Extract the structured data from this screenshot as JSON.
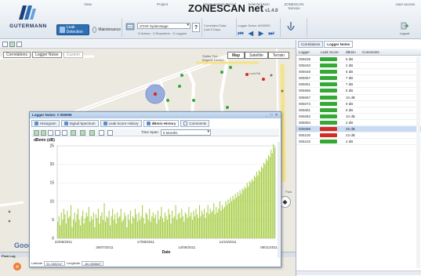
{
  "app": {
    "title": "ZONESCAN net",
    "version": "v1.4.8",
    "company": "GUTERMANN"
  },
  "header": {
    "sections": [
      "View",
      "Project",
      "Measurement Period",
      "Selected Item",
      "ZONESCAN Service",
      "User access"
    ],
    "leak_detection": "Leak Detection",
    "maintenance": "Maintenance",
    "project_value": "STAR Sydenstage",
    "project_stats": "5 Noises · 0 Repeaters · 6 Loggers",
    "help": "?",
    "measurement_line1": "Correlated Data",
    "measurement_line2": "Last 3 Days",
    "selected_line1": "Logger Noise: #005099",
    "nav_arrows": [
      "⏮",
      "◀",
      "▶",
      "⏭"
    ],
    "logout": "Logout"
  },
  "map": {
    "tabs": [
      "Correlations",
      "Logger Noise",
      "Custom"
    ],
    "types": [
      "Map",
      "Satellite",
      "Terrain"
    ],
    "place_labels": [
      "Slatter Fire Brigade District",
      "Lord Rd",
      "Park"
    ],
    "google_mark": "Google",
    "flow_log": "Flow Log"
  },
  "dialog": {
    "title": "Logger Notes: # 005099",
    "window_buttons": "_ □ ×",
    "tabs": [
      "Histogram",
      "Signal Spectrum",
      "Leak Score History",
      "dBmin History",
      "Comments"
    ],
    "active_tab_index": 3,
    "time_span_label": "Time Span:",
    "time_span_value": "6 Months",
    "latitude_label": "Latitude",
    "latitude_value": "51.158214°",
    "longitude_label": "Longitude",
    "longitude_value": "-80.280666°"
  },
  "right_panel": {
    "tabs": [
      "Correlations",
      "Logger Notes"
    ],
    "columns": [
      "Logger",
      "Leak Score",
      "dBmin",
      "Comments"
    ],
    "rows": [
      {
        "logger": "005039",
        "dbmin": "6 dB",
        "status": "ok"
      },
      {
        "logger": "005040",
        "dbmin": "2 dB",
        "status": "ok"
      },
      {
        "logger": "005048",
        "dbmin": "5 dB",
        "status": "ok"
      },
      {
        "logger": "005057",
        "dbmin": "7 dB",
        "status": "ok"
      },
      {
        "logger": "005061",
        "dbmin": "7 dB",
        "status": "ok"
      },
      {
        "logger": "005065",
        "dbmin": "5 dB",
        "status": "ok"
      },
      {
        "logger": "005067",
        "dbmin": "10 dB",
        "status": "ok"
      },
      {
        "logger": "005073",
        "dbmin": "9 dB",
        "status": "ok"
      },
      {
        "logger": "005081",
        "dbmin": "6 dB",
        "status": "ok"
      },
      {
        "logger": "005082",
        "dbmin": "10 dB",
        "status": "ok"
      },
      {
        "logger": "005094",
        "dbmin": "2 dB",
        "status": "ok"
      },
      {
        "logger": "005099",
        "dbmin": "25 dB",
        "status": "leak",
        "selected": true
      },
      {
        "logger": "005100",
        "dbmin": "23 dB",
        "status": "leak"
      },
      {
        "logger": "005102",
        "dbmin": "2 dB",
        "status": "ok"
      }
    ]
  },
  "colors": {
    "ok": "#35a935",
    "leak": "#d62b23",
    "bar": "#a7cd45",
    "accent": "#2e6fb4"
  },
  "chart_data": {
    "type": "bar",
    "title": "dBmin (dB)",
    "xlabel": "Date",
    "ylabel": "dBmin (dB)",
    "ylim": [
      0,
      25
    ],
    "yticks": [
      0,
      5,
      10,
      15,
      20,
      25
    ],
    "x_tick_labels": [
      "22/06/2011",
      "26/07/2011",
      "17/08/2011",
      "14/09/2011",
      "11/10/2011",
      "08/11/2011"
    ],
    "series": [
      {
        "values": [
          4.5,
          6,
          3.5,
          7,
          5,
          8,
          6.5,
          4,
          7.5,
          5.5,
          6,
          9,
          3,
          5,
          7,
          4.5,
          6.5,
          8,
          5,
          3.5,
          6,
          7.5,
          4,
          5.5,
          7,
          6,
          8.5,
          4.5,
          6,
          5,
          7,
          3,
          6.5,
          5.5,
          8,
          4,
          6,
          7,
          5,
          9.5,
          4.5,
          6,
          5.5,
          7.5,
          3.5,
          6,
          8,
          5,
          6.5,
          4,
          7,
          5.5,
          6,
          8,
          4.5,
          5,
          7,
          6,
          3,
          6.5,
          5,
          7.5,
          4,
          6,
          5.5,
          8,
          6.5,
          4.5,
          7,
          5,
          6,
          9,
          5.5,
          4,
          7,
          6.5,
          5,
          8,
          4.5,
          6,
          7,
          5.5,
          6.5,
          4,
          7.5,
          5,
          6,
          8.5,
          5.5,
          4.5,
          7,
          6,
          5,
          8,
          6.5,
          4,
          7.5,
          5.5,
          6,
          9,
          5,
          6.5,
          7,
          5.5,
          8,
          6,
          4.5,
          7,
          6.5,
          5.5,
          8.5,
          6,
          7,
          5,
          7.5,
          6,
          8,
          6.5,
          5.5,
          9,
          6,
          7.5,
          6.5,
          8,
          5.5,
          7,
          9,
          6.5,
          8,
          7,
          7.5,
          9.5,
          6.5,
          8.5,
          7,
          8,
          10,
          7.5,
          9,
          8,
          8.5,
          10,
          9,
          10.5,
          9.5,
          11,
          10,
          11.5,
          10.5,
          12,
          11,
          12.5,
          11.5,
          13,
          12,
          13.5,
          13,
          14,
          13.5,
          15,
          14,
          15.5,
          15,
          16,
          15.5,
          17,
          16.5,
          18,
          17,
          18.5,
          18,
          19.5,
          19,
          20.5,
          20,
          21.5,
          21,
          22.5,
          22,
          24,
          23,
          25.5,
          24.5
        ]
      }
    ]
  }
}
